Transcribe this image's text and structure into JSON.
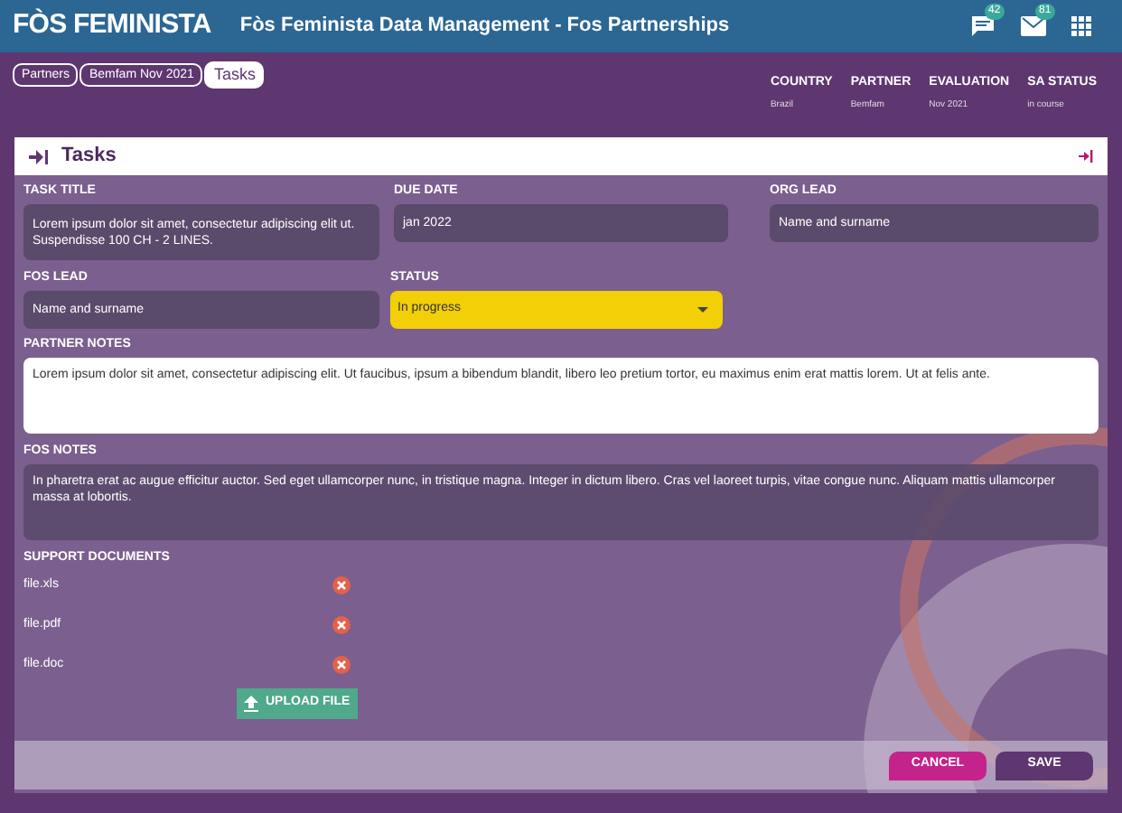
{
  "header": {
    "logo": "FÒS FEMINISTA",
    "title": "Fòs Feminista Data Management - Fos Partnerships",
    "chat_count": "42",
    "mail_count": "81"
  },
  "breadcrumbs": [
    {
      "label": "Partners",
      "selected": false
    },
    {
      "label": "Bemfam Nov 2021",
      "selected": false
    },
    {
      "label": "Tasks",
      "selected": true
    }
  ],
  "summary": [
    {
      "label": "COUNTRY",
      "value": "Brazil"
    },
    {
      "label": "PARTNER",
      "value": "Bemfam"
    },
    {
      "label": "EVALUATION",
      "value": "Nov 2021"
    },
    {
      "label": "SA STATUS",
      "value": "in course"
    }
  ],
  "panel": {
    "title": "Tasks"
  },
  "fields": {
    "task_title": {
      "label": "TASK TITLE",
      "value": "Lorem ipsum dolor sit amet, consectetur adipiscing elit ut. Suspendisse   100 CH - 2 LINES."
    },
    "due_date": {
      "label": "DUE DATE",
      "value": "jan 2022"
    },
    "org_lead": {
      "label": "ORG LEAD",
      "value": "Name and surname"
    },
    "fos_lead": {
      "label": "FOS LEAD",
      "value": "Name and surname"
    },
    "status": {
      "label": "STATUS",
      "value": "In progress"
    },
    "partner_notes": {
      "label": "PARTNER NOTES",
      "value": "Lorem ipsum dolor sit amet, consectetur adipiscing elit. Ut faucibus, ipsum a bibendum blandit, libero leo pretium tortor, eu maximus enim erat mattis lorem. Ut at felis ante."
    },
    "fos_notes": {
      "label": "FOS NOTES",
      "value": "In pharetra erat ac augue efficitur auctor. Sed eget ullamcorper nunc, in tristique magna. Integer in dictum libero. Cras vel laoreet turpis, vitae congue nunc. Aliquam mattis ullamcorper massa at lobortis."
    }
  },
  "support_documents": {
    "label": "SUPPORT DOCUMENTS",
    "files": [
      "file.xls",
      "file.pdf",
      "file.doc"
    ],
    "upload_button": "UPLOAD FILE"
  },
  "buttons": {
    "cancel": "CANCEL",
    "save": "SAVE"
  }
}
